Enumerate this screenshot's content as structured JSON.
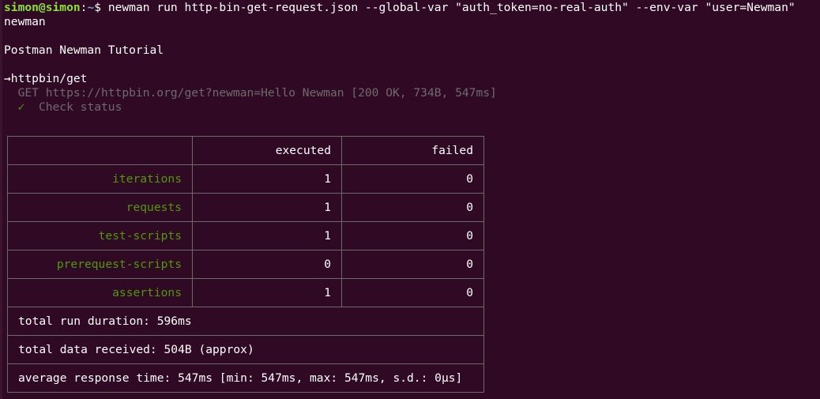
{
  "terminal": {
    "prompt": {
      "user_host": "simon@simon",
      "colon": ":",
      "path": "~",
      "symbol": "$ "
    },
    "command": "newman run http-bin-get-request.json --global-var \"auth_token=no-real-auth\" --env-var \"user=Newman\"",
    "output": {
      "tool_name": "newman",
      "collection_name": "Postman Newman Tutorial",
      "request_arrow": "→",
      "request_name": "httpbin/get",
      "request_line": "  GET https://httpbin.org/get?newman=Hello Newman [200 OK, 734B, 547ms]",
      "assertion_icon": "✓",
      "assertion_text": "  Check status"
    }
  },
  "summary": {
    "headers": [
      "",
      "executed",
      "failed"
    ],
    "rows": [
      {
        "label": "iterations",
        "executed": "1",
        "failed": "0"
      },
      {
        "label": "requests",
        "executed": "1",
        "failed": "0"
      },
      {
        "label": "test-scripts",
        "executed": "1",
        "failed": "0"
      },
      {
        "label": "prerequest-scripts",
        "executed": "0",
        "failed": "0"
      },
      {
        "label": "assertions",
        "executed": "1",
        "failed": "0"
      }
    ],
    "total_run_duration": "total run duration: 596ms",
    "total_data_received": "total data received: 504B (approx)",
    "average_response_time": "average response time: 547ms [min: 547ms, max: 547ms, s.d.: 0µs]"
  },
  "colors": {
    "background": "#300a24",
    "prompt_green": "#8ae234",
    "prompt_blue": "#729fcf",
    "label_green": "#4e9a06",
    "dim_gray": "#6f6a6b",
    "table_border": "#6b6b6b"
  }
}
